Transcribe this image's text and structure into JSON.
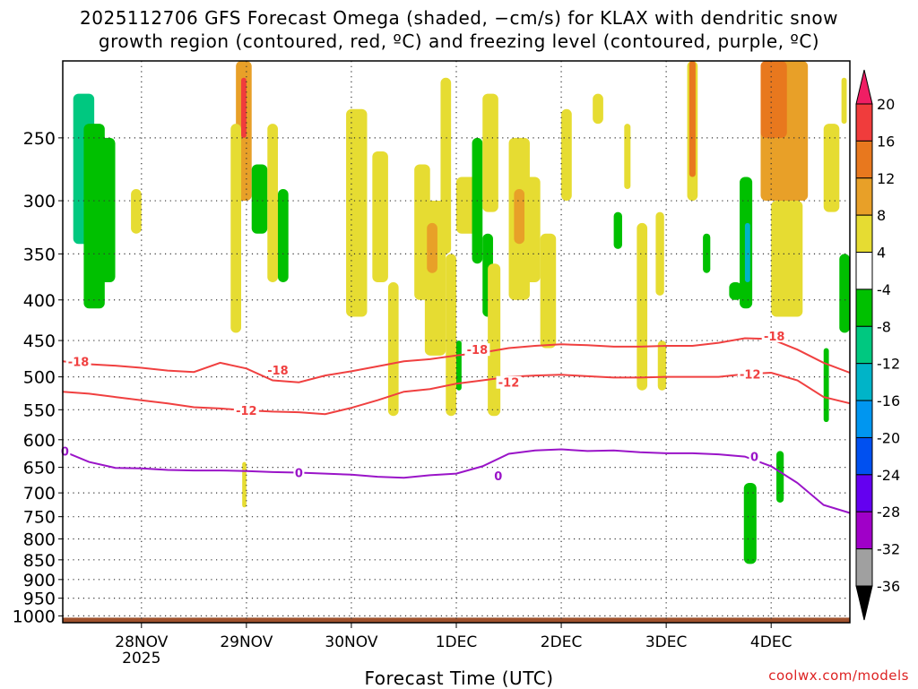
{
  "title_line1": "2025112706 GFS Forecast Omega (shaded, −cm/s) for KLAX with dendritic snow",
  "title_line2": "growth region (contoured, red, ºC) and freezing level (contoured, purple, ºC)",
  "credit": "coolwx.com/models",
  "chart_data": {
    "type": "heatmap",
    "title": "2025112706 GFS Forecast Omega (shaded, −cm/s) for KLAX with dendritic snow growth region (contoured, red, ºC) and freezing level (contoured, purple, ºC)",
    "xlabel": "Forecast Time (UTC)",
    "ylabel": "",
    "x_ticks": [
      "28NOV",
      "29NOV",
      "30NOV",
      "1DEC",
      "2DEC",
      "3DEC",
      "4DEC"
    ],
    "x_tick_sublabel": "2025",
    "x_range_days": [
      -0.75,
      6.75
    ],
    "y_ticks": [
      250,
      300,
      350,
      400,
      450,
      500,
      550,
      600,
      650,
      700,
      750,
      800,
      850,
      900,
      950,
      1000
    ],
    "y_range_hpa": [
      200,
      1020
    ],
    "y_scale": "log",
    "grid": true,
    "colorbar": {
      "labels": [
        "20",
        "16",
        "12",
        "8",
        "4",
        "-4",
        "-8",
        "-12",
        "-16",
        "-20",
        "-24",
        "-28",
        "-32",
        "-36"
      ],
      "colors": [
        "#f01e64",
        "#f03c3c",
        "#e8781e",
        "#e8a028",
        "#e6dc32",
        "#ffffff",
        "#00c000",
        "#00c880",
        "#00b4c8",
        "#0096f0",
        "#0050f0",
        "#6400f0",
        "#a000c8",
        "#a0a0a0",
        "#000000"
      ]
    },
    "contours": [
      {
        "label": "-18",
        "color": "#f04040",
        "x": [
          -0.75,
          -0.5,
          -0.25,
          0.0,
          0.25,
          0.5,
          0.75,
          1.0,
          1.25,
          1.5,
          1.75,
          2.0,
          2.25,
          2.5,
          2.75,
          3.0,
          3.25,
          3.5,
          3.75,
          4.0,
          4.25,
          4.5,
          4.75,
          5.0,
          5.25,
          5.5,
          5.75,
          6.0,
          6.25,
          6.5,
          6.75
        ],
        "y": [
          478,
          482,
          484,
          487,
          491,
          493,
          480,
          488,
          505,
          508,
          498,
          492,
          485,
          478,
          475,
          470,
          466,
          460,
          457,
          455,
          456,
          458,
          458,
          457,
          457,
          453,
          447,
          448,
          462,
          480,
          494
        ]
      },
      {
        "label": "-12",
        "color": "#f04040",
        "x": [
          -0.75,
          -0.5,
          -0.25,
          0.0,
          0.25,
          0.5,
          0.75,
          1.0,
          1.25,
          1.5,
          1.75,
          2.0,
          2.25,
          2.5,
          2.75,
          3.0,
          3.25,
          3.5,
          3.75,
          4.0,
          4.25,
          4.5,
          4.75,
          5.0,
          5.25,
          5.5,
          5.75,
          6.0,
          6.25,
          6.5,
          6.75
        ],
        "y": [
          522,
          525,
          530,
          535,
          540,
          546,
          548,
          551,
          553,
          554,
          557,
          547,
          535,
          522,
          518,
          510,
          505,
          500,
          498,
          497,
          499,
          501,
          501,
          500,
          500,
          500,
          496,
          494,
          505,
          530,
          540
        ]
      },
      {
        "label": "0",
        "color": "#9a14c8",
        "x": [
          -0.75,
          -0.5,
          -0.25,
          0.0,
          0.25,
          0.5,
          0.75,
          1.0,
          1.25,
          1.5,
          1.75,
          2.0,
          2.25,
          2.5,
          2.75,
          3.0,
          3.25,
          3.5,
          3.75,
          4.0,
          4.25,
          4.5,
          4.75,
          5.0,
          5.25,
          5.5,
          5.75,
          6.0,
          6.25,
          6.5,
          6.75
        ],
        "y": [
          620,
          640,
          651,
          652,
          655,
          656,
          656,
          657,
          659,
          660,
          662,
          664,
          668,
          670,
          665,
          662,
          648,
          625,
          619,
          617,
          620,
          619,
          622,
          624,
          624,
          626,
          630,
          648,
          680,
          725,
          742
        ]
      }
    ],
    "contour_labels": [
      {
        "text": "-18",
        "x": -0.6,
        "y": 478
      },
      {
        "text": "-18",
        "x": 1.3,
        "y": 490
      },
      {
        "text": "-18",
        "x": 3.2,
        "y": 462
      },
      {
        "text": "-18",
        "x": 6.03,
        "y": 444
      },
      {
        "text": "-12",
        "x": 1.0,
        "y": 551
      },
      {
        "text": "-12",
        "x": 3.5,
        "y": 508
      },
      {
        "text": "-12",
        "x": 5.8,
        "y": 496
      },
      {
        "text": "0",
        "x": -0.73,
        "y": 620
      },
      {
        "text": "0",
        "x": 1.5,
        "y": 660
      },
      {
        "text": "0",
        "x": 3.4,
        "y": 666
      },
      {
        "text": "0",
        "x": 5.84,
        "y": 630
      }
    ],
    "shaded_cells": [
      {
        "x0": -0.65,
        "x1": -0.45,
        "p0": 220,
        "p1": 340,
        "value": -12
      },
      {
        "x0": -0.55,
        "x1": -0.35,
        "p0": 240,
        "p1": 410,
        "value": -8
      },
      {
        "x0": -0.4,
        "x1": -0.25,
        "p0": 250,
        "p1": 380,
        "value": -8
      },
      {
        "x0": -0.1,
        "x1": 0.0,
        "p0": 290,
        "p1": 330,
        "value": 4
      },
      {
        "x0": 0.9,
        "x1": 1.05,
        "p0": 200,
        "p1": 300,
        "value": 8
      },
      {
        "x0": 0.95,
        "x1": 1.0,
        "p0": 210,
        "p1": 250,
        "value": 16
      },
      {
        "x0": 0.85,
        "x1": 0.95,
        "p0": 240,
        "p1": 440,
        "value": 4
      },
      {
        "x0": 1.05,
        "x1": 1.2,
        "p0": 270,
        "p1": 330,
        "value": -8
      },
      {
        "x0": 1.2,
        "x1": 1.3,
        "p0": 240,
        "p1": 380,
        "value": 4
      },
      {
        "x0": 1.3,
        "x1": 1.4,
        "p0": 290,
        "p1": 380,
        "value": -8
      },
      {
        "x0": 0.96,
        "x1": 1.0,
        "p0": 640,
        "p1": 730,
        "value": 4
      },
      {
        "x0": 1.95,
        "x1": 2.15,
        "p0": 230,
        "p1": 420,
        "value": 4
      },
      {
        "x0": 2.2,
        "x1": 2.35,
        "p0": 260,
        "p1": 380,
        "value": 4
      },
      {
        "x0": 2.35,
        "x1": 2.45,
        "p0": 380,
        "p1": 560,
        "value": 4
      },
      {
        "x0": 2.6,
        "x1": 2.75,
        "p0": 270,
        "p1": 400,
        "value": 4
      },
      {
        "x0": 2.7,
        "x1": 2.9,
        "p0": 300,
        "p1": 470,
        "value": 4
      },
      {
        "x0": 2.72,
        "x1": 2.82,
        "p0": 320,
        "p1": 370,
        "value": 8
      },
      {
        "x0": 2.85,
        "x1": 2.95,
        "p0": 210,
        "p1": 350,
        "value": 4
      },
      {
        "x0": 2.9,
        "x1": 3.0,
        "p0": 350,
        "p1": 560,
        "value": 4
      },
      {
        "x0": 3.0,
        "x1": 3.05,
        "p0": 450,
        "p1": 520,
        "value": -8
      },
      {
        "x0": 3.0,
        "x1": 3.2,
        "p0": 280,
        "p1": 330,
        "value": 4
      },
      {
        "x0": 3.15,
        "x1": 3.25,
        "p0": 250,
        "p1": 360,
        "value": -8
      },
      {
        "x0": 3.25,
        "x1": 3.4,
        "p0": 220,
        "p1": 310,
        "value": 4
      },
      {
        "x0": 3.25,
        "x1": 3.35,
        "p0": 330,
        "p1": 420,
        "value": -8
      },
      {
        "x0": 3.3,
        "x1": 3.42,
        "p0": 360,
        "p1": 560,
        "value": 4
      },
      {
        "x0": 3.5,
        "x1": 3.7,
        "p0": 250,
        "p1": 400,
        "value": 4
      },
      {
        "x0": 3.55,
        "x1": 3.65,
        "p0": 290,
        "p1": 340,
        "value": 8
      },
      {
        "x0": 3.65,
        "x1": 3.8,
        "p0": 280,
        "p1": 380,
        "value": 4
      },
      {
        "x0": 3.8,
        "x1": 3.95,
        "p0": 330,
        "p1": 460,
        "value": 4
      },
      {
        "x0": 4.0,
        "x1": 4.1,
        "p0": 230,
        "p1": 300,
        "value": 4
      },
      {
        "x0": 4.3,
        "x1": 4.4,
        "p0": 220,
        "p1": 240,
        "value": 4
      },
      {
        "x0": 4.5,
        "x1": 4.58,
        "p0": 310,
        "p1": 345,
        "value": -8
      },
      {
        "x0": 4.72,
        "x1": 4.82,
        "p0": 320,
        "p1": 520,
        "value": 4
      },
      {
        "x0": 5.2,
        "x1": 5.3,
        "p0": 200,
        "p1": 300,
        "value": 4
      },
      {
        "x0": 5.22,
        "x1": 5.28,
        "p0": 200,
        "p1": 280,
        "value": 12
      },
      {
        "x0": 5.35,
        "x1": 5.42,
        "p0": 330,
        "p1": 370,
        "value": -8
      },
      {
        "x0": 5.6,
        "x1": 5.72,
        "p0": 380,
        "p1": 400,
        "value": -8
      },
      {
        "x0": 5.7,
        "x1": 5.82,
        "p0": 280,
        "p1": 410,
        "value": -8
      },
      {
        "x0": 5.75,
        "x1": 5.8,
        "p0": 320,
        "p1": 380,
        "value": -16
      },
      {
        "x0": 5.9,
        "x1": 6.35,
        "p0": 200,
        "p1": 300,
        "value": 8
      },
      {
        "x0": 5.9,
        "x1": 6.15,
        "p0": 200,
        "p1": 250,
        "value": 12
      },
      {
        "x0": 6.0,
        "x1": 6.3,
        "p0": 300,
        "p1": 420,
        "value": 4
      },
      {
        "x0": 6.5,
        "x1": 6.65,
        "p0": 240,
        "p1": 310,
        "value": 4
      },
      {
        "x0": 6.5,
        "x1": 6.55,
        "p0": 460,
        "p1": 570,
        "value": -8
      },
      {
        "x0": 6.67,
        "x1": 6.72,
        "p0": 210,
        "p1": 240,
        "value": 4
      },
      {
        "x0": 6.65,
        "x1": 6.75,
        "p0": 350,
        "p1": 440,
        "value": -8
      },
      {
        "x0": 5.74,
        "x1": 5.86,
        "p0": 680,
        "p1": 860,
        "value": -8
      },
      {
        "x0": 6.05,
        "x1": 6.12,
        "p0": 620,
        "p1": 720,
        "value": -8
      },
      {
        "x0": 4.6,
        "x1": 4.66,
        "p0": 240,
        "p1": 290,
        "value": 4
      },
      {
        "x0": 4.9,
        "x1": 4.98,
        "p0": 310,
        "p1": 395,
        "value": 4
      },
      {
        "x0": 4.92,
        "x1": 5.0,
        "p0": 450,
        "p1": 520,
        "value": 4
      }
    ],
    "surface": {
      "color": "#a0522d",
      "p_top": 1000
    }
  }
}
